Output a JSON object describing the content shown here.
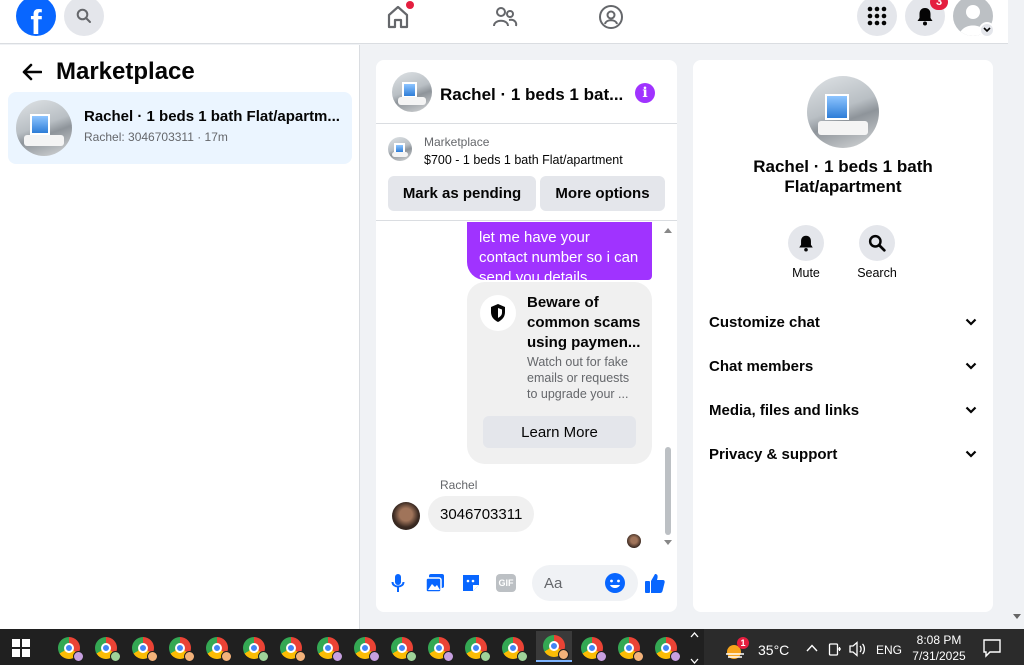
{
  "topbar": {
    "logo_letter": "f",
    "notification_count": "3"
  },
  "left": {
    "title": "Marketplace",
    "conversation": {
      "name": "Rachel · 1 beds 1 bath Flat/apartm...",
      "snippet": "Rachel: 3046703311 · 17m"
    }
  },
  "chat": {
    "header_title": "Rachel · 1 beds 1 bat...",
    "info_glyph": "i",
    "listing_source": "Marketplace",
    "listing_title": "$700 - 1 beds 1 bath Flat/apartment",
    "mark_pending_label": "Mark as pending",
    "more_options_label": "More options",
    "outgoing_message_lines": [
      "let me have your",
      "contact number so i can",
      "send you details"
    ],
    "scam_card": {
      "title_lines": [
        "Beware of",
        "common scams",
        "using paymen..."
      ],
      "body_lines": [
        "Watch out for fake",
        "emails or requests",
        "to upgrade your ..."
      ],
      "learn_more_label": "Learn More"
    },
    "sender_name": "Rachel",
    "incoming_message": "3046703311",
    "composer_placeholder": "Aa",
    "gif_label": "GIF"
  },
  "right": {
    "title_line1": "Rachel · 1 beds 1 bath",
    "title_line2": "Flat/apartment",
    "mute_label": "Mute",
    "search_label": "Search",
    "sections": [
      "Customize chat",
      "Chat members",
      "Media, files and links",
      "Privacy & support"
    ]
  },
  "taskbar": {
    "weather_badge": "1",
    "temperature": "35°C",
    "language": "ENG",
    "time": "8:08 PM",
    "date": "7/31/2025"
  },
  "colors": {
    "facebook_blue": "#0866ff",
    "messenger_purple": "#a033ff",
    "selected_conversation": "#ebf5ff",
    "notification_red": "#e41e3f"
  }
}
